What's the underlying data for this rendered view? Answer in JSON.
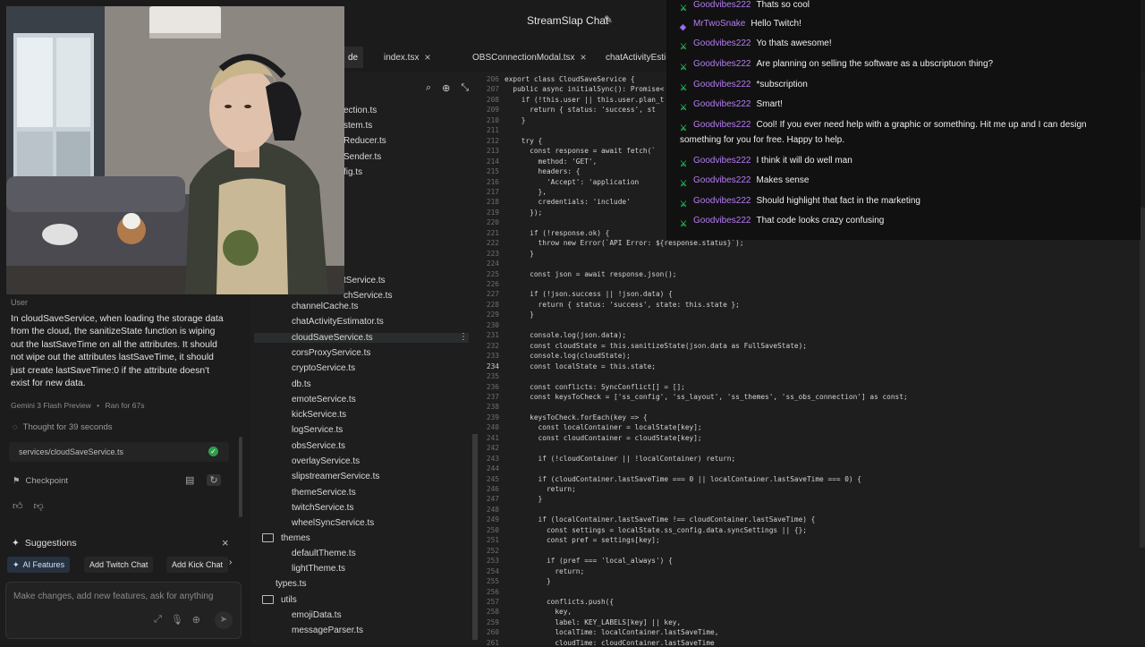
{
  "window": {
    "title": "StreamSlap Chat"
  },
  "tabs": [
    {
      "label": "de",
      "active": true
    },
    {
      "label": "index.tsx"
    },
    {
      "label": "OBSConnectionModal.tsx"
    },
    {
      "label": "chatActivityEstimat"
    }
  ],
  "explorer": {
    "partial_items": [
      "ection.ts",
      "stem.ts",
      "Reducer.ts",
      "Sender.ts",
      "fig.ts",
      "tService.ts",
      "chService.ts"
    ],
    "services": [
      "channelCache.ts",
      "chatActivityEstimator.ts",
      "cloudSaveService.ts",
      "corsProxyService.ts",
      "cryptoService.ts",
      "db.ts",
      "emoteService.ts",
      "kickService.ts",
      "logService.ts",
      "obsService.ts",
      "overlayService.ts",
      "slipstreamerService.ts",
      "themeService.ts",
      "twitchService.ts",
      "wheelSyncService.ts"
    ],
    "selected": "cloudSaveService.ts",
    "themes_folder": "themes",
    "themes": [
      "defaultTheme.ts",
      "lightTheme.ts"
    ],
    "types_file": "types.ts",
    "utils_folder": "utils",
    "utils": [
      "emojiData.ts",
      "messageParser.ts"
    ]
  },
  "chat": {
    "user_label": "User",
    "user_message": "In cloudSaveService, when loading the storage data from the cloud, the sanitizeState function is wiping out the lastSaveTime on all the attributes. It should not wipe out the attributes lastSaveTime, it should just create lastSaveTime:0 if the attribute doesn't exist for new data.",
    "model": "Gemini 3 Flash Preview",
    "ran_for": "Ran for 67s",
    "thought": "Thought for 39 seconds",
    "file_chip": "services/cloudSaveService.ts",
    "checkpoint": "Checkpoint",
    "suggestions_title": "Suggestions",
    "suggestions": [
      "AI Features",
      "Add Twitch Chat",
      "Add Kick Chat"
    ],
    "input_placeholder": "Make changes, add new features, ask for anything"
  },
  "code": {
    "lines": [
      {
        "n": "206",
        "t": "export class CloudSaveService {"
      },
      {
        "n": "207",
        "t": "  public async initialSync(): Promise<"
      },
      {
        "n": "208",
        "t": "    if (!this.user || this.user.plan_t"
      },
      {
        "n": "209",
        "t": "      return { status: 'success', st"
      },
      {
        "n": "210",
        "t": "    }"
      },
      {
        "n": "211",
        "t": ""
      },
      {
        "n": "212",
        "t": "    try {"
      },
      {
        "n": "213",
        "t": "      const response = await fetch(`"
      },
      {
        "n": "214",
        "t": "        method: 'GET',"
      },
      {
        "n": "215",
        "t": "        headers: {"
      },
      {
        "n": "216",
        "t": "          'Accept': 'application"
      },
      {
        "n": "217",
        "t": "        },"
      },
      {
        "n": "218",
        "t": "        credentials: 'include'"
      },
      {
        "n": "219",
        "t": "      });"
      },
      {
        "n": "220",
        "t": ""
      },
      {
        "n": "221",
        "t": "      if (!response.ok) {"
      },
      {
        "n": "222",
        "t": "        throw new Error(`API Error: ${response.status}`);"
      },
      {
        "n": "223",
        "t": "      }"
      },
      {
        "n": "224",
        "t": ""
      },
      {
        "n": "225",
        "t": "      const json = await response.json();"
      },
      {
        "n": "226",
        "t": ""
      },
      {
        "n": "227",
        "t": "      if (!json.success || !json.data) {"
      },
      {
        "n": "228",
        "t": "        return { status: 'success', state: this.state };"
      },
      {
        "n": "229",
        "t": "      }"
      },
      {
        "n": "230",
        "t": ""
      },
      {
        "n": "231",
        "t": "      console.log(json.data);"
      },
      {
        "n": "232",
        "t": "      const cloudState = this.sanitizeState(json.data as FullSaveState);"
      },
      {
        "n": "233",
        "t": "      console.log(cloudState);"
      },
      {
        "n": "234",
        "t": "      const localState = this.state;"
      },
      {
        "n": "235",
        "t": ""
      },
      {
        "n": "236",
        "t": "      const conflicts: SyncConflict[] = [];"
      },
      {
        "n": "237",
        "t": "      const keysToCheck = ['ss_config', 'ss_layout', 'ss_themes', 'ss_obs_connection'] as const;"
      },
      {
        "n": "238",
        "t": ""
      },
      {
        "n": "239",
        "t": "      keysToCheck.forEach(key => {"
      },
      {
        "n": "240",
        "t": "        const localContainer = localState[key];"
      },
      {
        "n": "241",
        "t": "        const cloudContainer = cloudState[key];"
      },
      {
        "n": "242",
        "t": ""
      },
      {
        "n": "243",
        "t": "        if (!cloudContainer || !localContainer) return;"
      },
      {
        "n": "244",
        "t": ""
      },
      {
        "n": "245",
        "t": "        if (cloudContainer.lastSaveTime === 0 || localContainer.lastSaveTime === 0) {"
      },
      {
        "n": "246",
        "t": "          return;"
      },
      {
        "n": "247",
        "t": "        }"
      },
      {
        "n": "248",
        "t": ""
      },
      {
        "n": "249",
        "t": "        if (localContainer.lastSaveTime !== cloudContainer.lastSaveTime) {"
      },
      {
        "n": "250",
        "t": "          const settings = localState.ss_config.data.syncSettings || {};"
      },
      {
        "n": "251",
        "t": "          const pref = settings[key];"
      },
      {
        "n": "252",
        "t": ""
      },
      {
        "n": "253",
        "t": "          if (pref === 'local_always') {"
      },
      {
        "n": "254",
        "t": "            return;"
      },
      {
        "n": "255",
        "t": "          }"
      },
      {
        "n": "256",
        "t": ""
      },
      {
        "n": "257",
        "t": "          conflicts.push({"
      },
      {
        "n": "258",
        "t": "            key,"
      },
      {
        "n": "259",
        "t": "            label: KEY_LABELS[key] || key,"
      },
      {
        "n": "260",
        "t": "            localTime: localContainer.lastSaveTime,"
      },
      {
        "n": "261",
        "t": "            cloudTime: cloudContainer.lastSaveTime"
      }
    ]
  },
  "twitch_chat": [
    {
      "user": "Goodvibes222",
      "msg": "Thats so cool",
      "badge": "mod"
    },
    {
      "user": "MrTwoSnake",
      "msg": "Hello Twitch!",
      "badge": "vip"
    },
    {
      "user": "Goodvibes222",
      "msg": "Yo thats awesome!",
      "badge": "mod"
    },
    {
      "user": "Goodvibes222",
      "msg": "Are planning on selling the software as a ubscriptuon thing?",
      "badge": "mod"
    },
    {
      "user": "Goodvibes222",
      "msg": "*subscription",
      "badge": "mod"
    },
    {
      "user": "Goodvibes222",
      "msg": "Smart!",
      "badge": "mod"
    },
    {
      "user": "Goodvibes222",
      "msg": "Cool! If you ever need help with a graphic or something. Hit me up and I can design something for you for free. Happy to help.",
      "badge": "mod"
    },
    {
      "user": "Goodvibes222",
      "msg": "I think it will do well man",
      "badge": "mod"
    },
    {
      "user": "Goodvibes222",
      "msg": "Makes sense",
      "badge": "mod"
    },
    {
      "user": "Goodvibes222",
      "msg": "Should highlight that fact in the marketing",
      "badge": "mod"
    },
    {
      "user": "Goodvibes222",
      "msg": "That code looks crazy confusing",
      "badge": "mod"
    }
  ],
  "colors": {
    "twitch_name": "#b57df4",
    "mod_badge": "#1db954",
    "vip_badge": "#a970ff",
    "accent": "#2e9d4b"
  }
}
